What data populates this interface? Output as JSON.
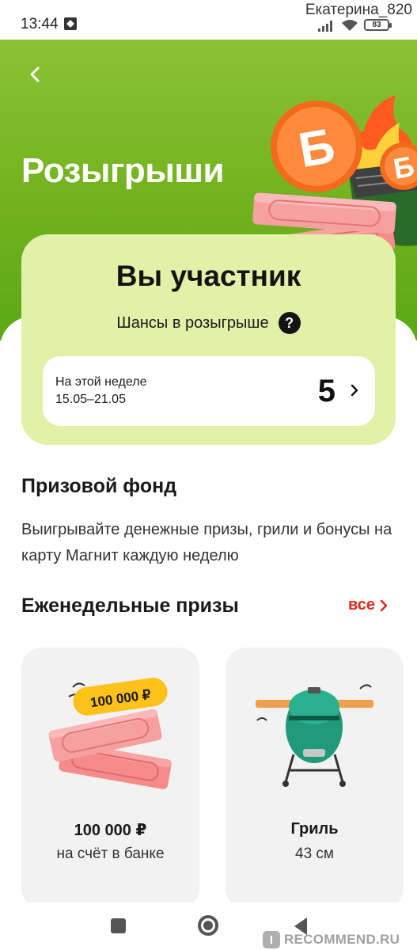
{
  "status_bar": {
    "time": "13:44",
    "user": "Екатерина_820",
    "battery": "83"
  },
  "header": {
    "title": "Розыгрыши",
    "coin_letter": "Б"
  },
  "participant": {
    "title": "Вы участник",
    "chances_label": "Шансы в розыгрыше",
    "help_symbol": "?",
    "week_label": "На этой неделе",
    "week_dates": "15.05–21.05",
    "week_count": "5"
  },
  "prize_fund": {
    "title": "Призовой фонд",
    "description": "Выигрывайте денежные призы, грили и бонусы на карту Магнит каждую неделю"
  },
  "weekly_prizes": {
    "title": "Еженедельные призы",
    "all_label": "все",
    "items": [
      {
        "badge": "100 000 ₽",
        "name": "100 000 ₽",
        "description": "на счёт в банке",
        "icon": "money-stack-icon"
      },
      {
        "name": "Гриль",
        "description": "43 см",
        "icon": "grill-icon"
      }
    ]
  },
  "watermark": {
    "badge": "I",
    "text": "RECOMMEND.RU"
  },
  "colors": {
    "hero_green": "#72b21e",
    "card_lime": "#e2f0a8",
    "accent_red": "#e1261c",
    "coin_orange": "#f26a1b"
  }
}
